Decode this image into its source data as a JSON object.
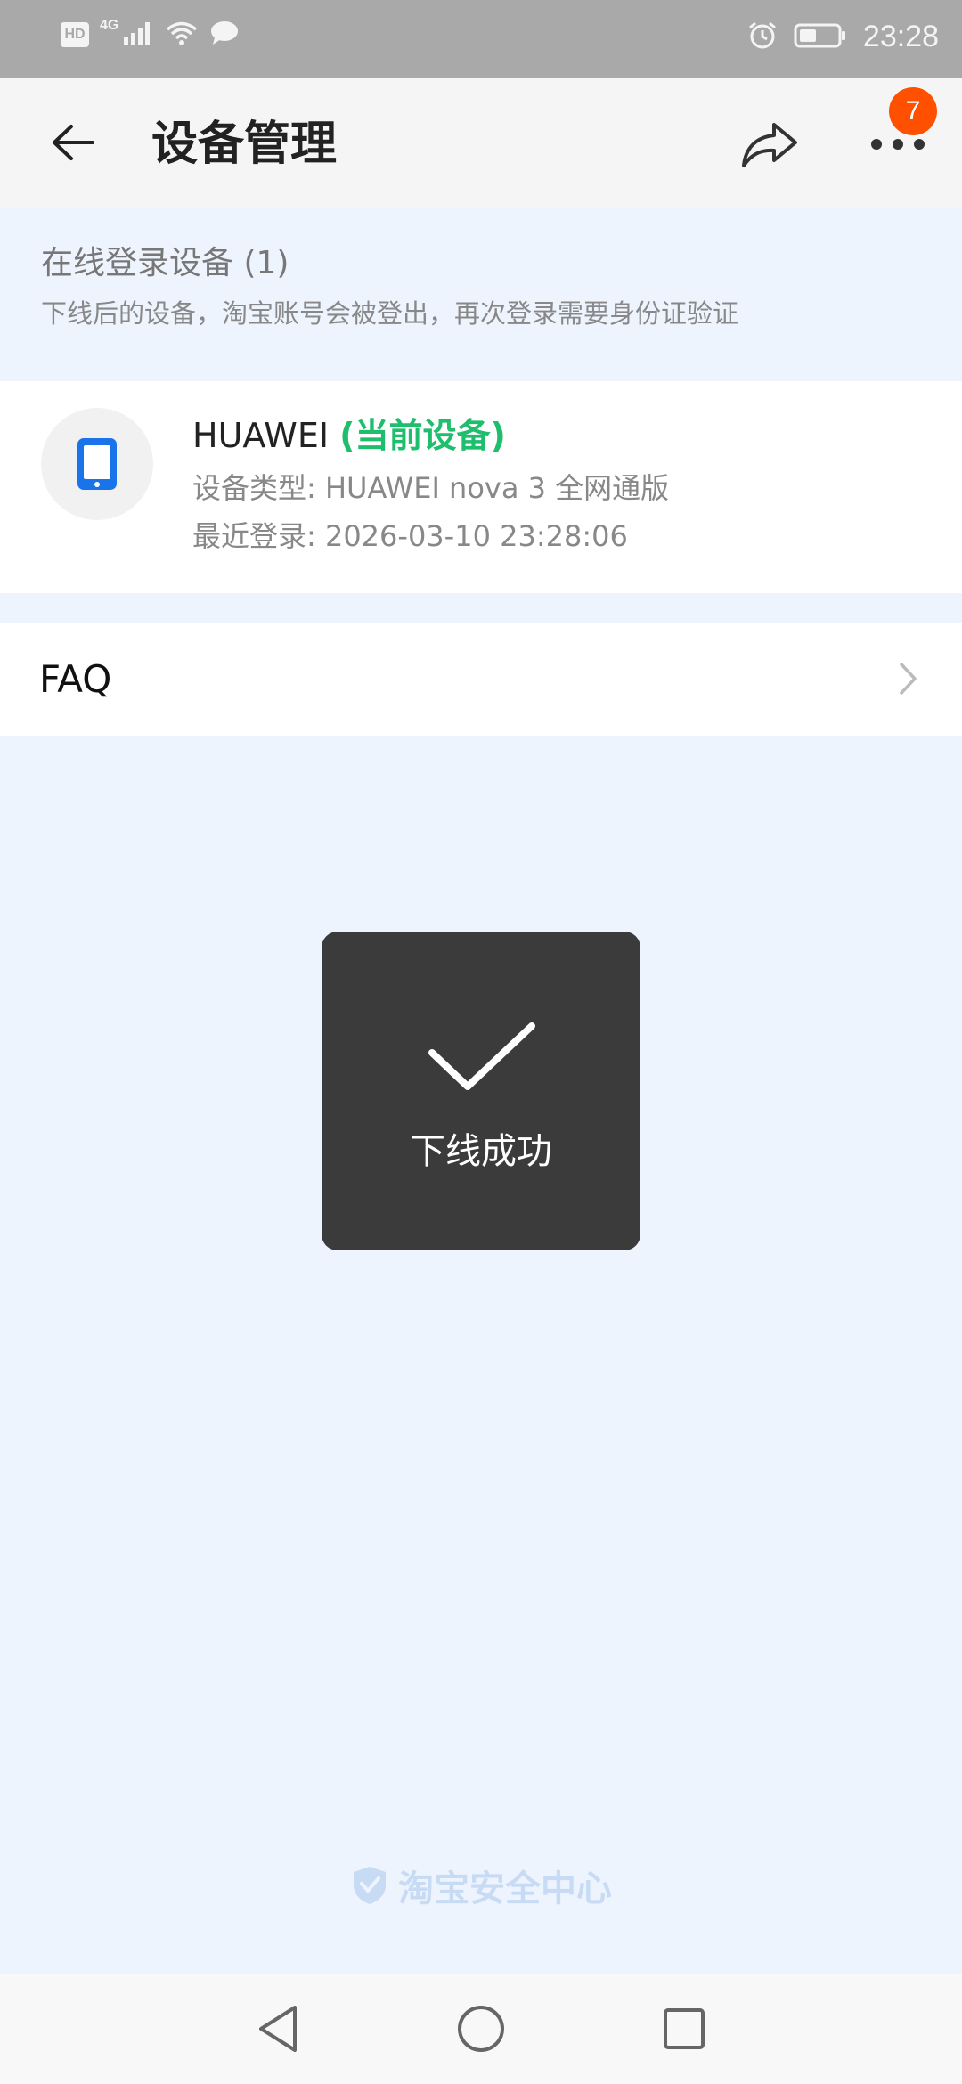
{
  "status_bar": {
    "network_type": "4G",
    "hd_label": "HD",
    "time": "23:28"
  },
  "header": {
    "title": "设备管理",
    "notification_count": "7"
  },
  "section": {
    "title": "在线登录设备 (1)",
    "description": "下线后的设备，淘宝账号会被登出，再次登录需要身份证验证"
  },
  "device": {
    "name": "HUAWEI",
    "current_label": "(当前设备)",
    "type_line": "设备类型: HUAWEI nova 3 全网通版",
    "last_login_line": "最近登录: 2026-03-10 23:28:06"
  },
  "faq": {
    "label": "FAQ"
  },
  "toast": {
    "message": "下线成功"
  },
  "footer": {
    "brand": "淘宝安全中心"
  },
  "colors": {
    "accent_green": "#1fbe6d",
    "badge_orange": "#ff5000",
    "page_background": "#eef4fe",
    "device_icon_blue": "#1a73e8"
  }
}
